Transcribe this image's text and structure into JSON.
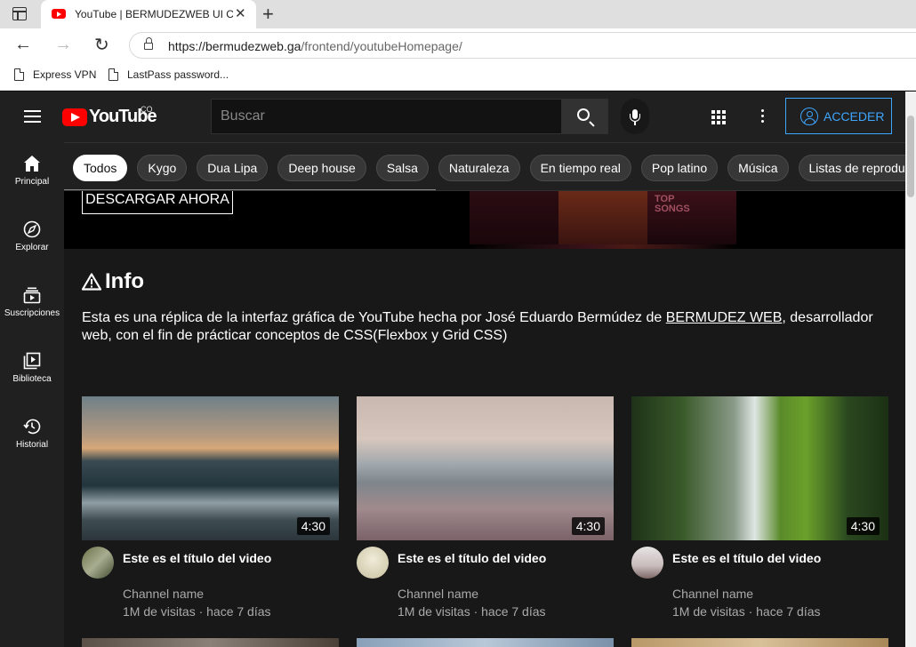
{
  "browser": {
    "tab_title": "YouTube | BERMUDEZWEB UI CLONE",
    "url_host": "https://bermudezweb.ga",
    "url_path": "/frontend/youtubeHomepage/",
    "bookmarks": [
      {
        "label": "Express VPN"
      },
      {
        "label": "LastPass password..."
      }
    ]
  },
  "header": {
    "logo_text": "YouTube",
    "logo_country": "CO",
    "search_placeholder": "Buscar",
    "signin_label": "ACCEDER"
  },
  "sidebar": {
    "items": [
      {
        "label": "Principal",
        "icon": "home-icon"
      },
      {
        "label": "Explorar",
        "icon": "compass-icon"
      },
      {
        "label": "Suscripciones",
        "icon": "subscriptions-icon"
      },
      {
        "label": "Biblioteca",
        "icon": "library-icon"
      },
      {
        "label": "Historial",
        "icon": "history-icon"
      }
    ]
  },
  "chips": [
    "Todos",
    "Kygo",
    "Dua Lipa",
    "Deep house",
    "Salsa",
    "Naturaleza",
    "En tiempo real",
    "Pop latino",
    "Música",
    "Listas de reproducción"
  ],
  "banner": {
    "cta_label": "DESCARGAR AHORA",
    "art_text": "TOP SONGS"
  },
  "info": {
    "title": "Info",
    "text_before": "Esta es una réplica de la interfaz gráfica de YouTube hecha por José Eduardo Bermúdez de ",
    "link_text": "BERMUDEZ WEB",
    "text_after": ", desarrollador web, con el fin de prácticar conceptos de CSS(Flexbox y Grid CSS)"
  },
  "videos": [
    {
      "duration": "4:30",
      "title": "Este es el título del video",
      "channel": "Channel name",
      "meta": "1M de visitas · hace 7 días"
    },
    {
      "duration": "4:30",
      "title": "Este es el título del video",
      "channel": "Channel name",
      "meta": "1M de visitas · hace 7 días"
    },
    {
      "duration": "4:30",
      "title": "Este es el título del video",
      "channel": "Channel name",
      "meta": "1M de visitas · hace 7 días"
    }
  ],
  "colors": {
    "brand_red": "#ff0000",
    "accent_blue": "#3ea6ff",
    "background": "#0f0f0f"
  }
}
